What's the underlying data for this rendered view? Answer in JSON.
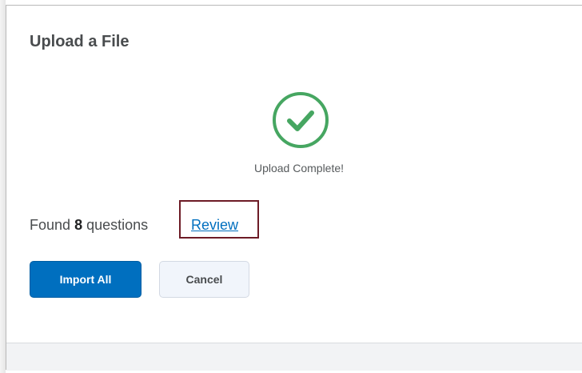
{
  "dialog": {
    "title": "Upload a File",
    "status_text": "Upload Complete!",
    "found_prefix": "Found",
    "question_count": "8",
    "found_suffix": "questions",
    "review_link_label": "Review"
  },
  "buttons": {
    "import_all_label": "Import All",
    "cancel_label": "Cancel"
  },
  "icons": {
    "status_icon": "check-circle-icon"
  },
  "colors": {
    "success": "#46a661",
    "primary": "#006fbf",
    "highlight_border": "#6d1b26"
  }
}
